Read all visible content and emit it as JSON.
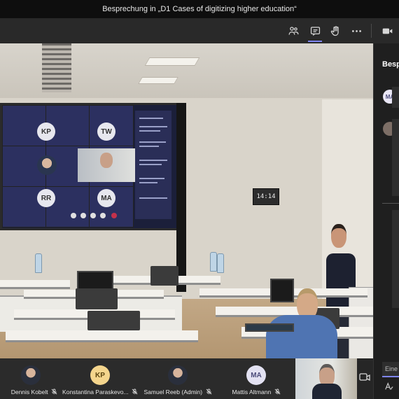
{
  "window": {
    "title": "Besprechung in „D1 Cases of digitizing higher education“"
  },
  "toolbar": {
    "icons": [
      "people-icon",
      "chat-icon",
      "raise-hand-icon",
      "more-icon",
      "camera-icon"
    ],
    "active": "chat-icon"
  },
  "stage": {
    "videowall": {
      "avatars": [
        "KP",
        "TW",
        "RR",
        "MA"
      ]
    },
    "clock_text": "14:14"
  },
  "chat": {
    "title": "Besprechung",
    "avatar_initials": "MA",
    "input_placeholder": "Eine neue Nachricht eingeben"
  },
  "participants": [
    {
      "name": "Dennis Kobelt",
      "type": "photo"
    },
    {
      "name": "Konstantina Paraskevo...",
      "type": "initials",
      "initials": "KP",
      "color": "#f4d58d"
    },
    {
      "name": "Samuel Reeb (Admin)",
      "type": "photo"
    },
    {
      "name": "Mattis Altmann",
      "type": "initials",
      "initials": "MA",
      "color": "#e3e2f2"
    }
  ],
  "colors": {
    "accent": "#7f85f5",
    "status_busy": "#c4314b"
  }
}
